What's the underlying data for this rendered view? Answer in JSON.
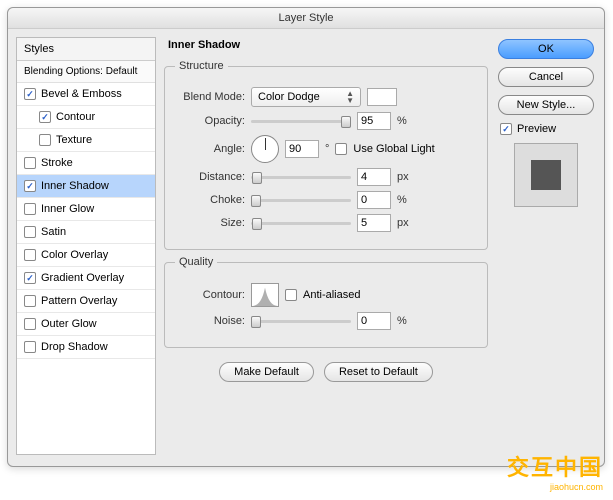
{
  "title": "Layer Style",
  "sidebar": {
    "header": "Styles",
    "blending": "Blending Options: Default",
    "items": [
      {
        "label": "Bevel & Emboss",
        "checked": true,
        "sub": false
      },
      {
        "label": "Contour",
        "checked": true,
        "sub": true
      },
      {
        "label": "Texture",
        "checked": false,
        "sub": true
      },
      {
        "label": "Stroke",
        "checked": false,
        "sub": false
      },
      {
        "label": "Inner Shadow",
        "checked": true,
        "sub": false,
        "selected": true
      },
      {
        "label": "Inner Glow",
        "checked": false,
        "sub": false
      },
      {
        "label": "Satin",
        "checked": false,
        "sub": false
      },
      {
        "label": "Color Overlay",
        "checked": false,
        "sub": false
      },
      {
        "label": "Gradient Overlay",
        "checked": true,
        "sub": false
      },
      {
        "label": "Pattern Overlay",
        "checked": false,
        "sub": false
      },
      {
        "label": "Outer Glow",
        "checked": false,
        "sub": false
      },
      {
        "label": "Drop Shadow",
        "checked": false,
        "sub": false
      }
    ]
  },
  "panel": {
    "title": "Inner Shadow",
    "structure": {
      "legend": "Structure",
      "blendModeLabel": "Blend Mode:",
      "blendMode": "Color Dodge",
      "opacityLabel": "Opacity:",
      "opacity": "95",
      "opacityUnit": "%",
      "angleLabel": "Angle:",
      "angle": "90",
      "angleUnit": "°",
      "globalLight": "Use Global Light",
      "distanceLabel": "Distance:",
      "distance": "4",
      "distanceUnit": "px",
      "chokeLabel": "Choke:",
      "choke": "0",
      "chokeUnit": "%",
      "sizeLabel": "Size:",
      "size": "5",
      "sizeUnit": "px"
    },
    "quality": {
      "legend": "Quality",
      "contourLabel": "Contour:",
      "antiAliased": "Anti-aliased",
      "noiseLabel": "Noise:",
      "noise": "0",
      "noiseUnit": "%"
    },
    "makeDefault": "Make Default",
    "resetDefault": "Reset to Default"
  },
  "right": {
    "ok": "OK",
    "cancel": "Cancel",
    "newStyle": "New Style...",
    "preview": "Preview"
  },
  "watermark": {
    "line1": "交互中国",
    "line2": "jiaohucn.com"
  }
}
